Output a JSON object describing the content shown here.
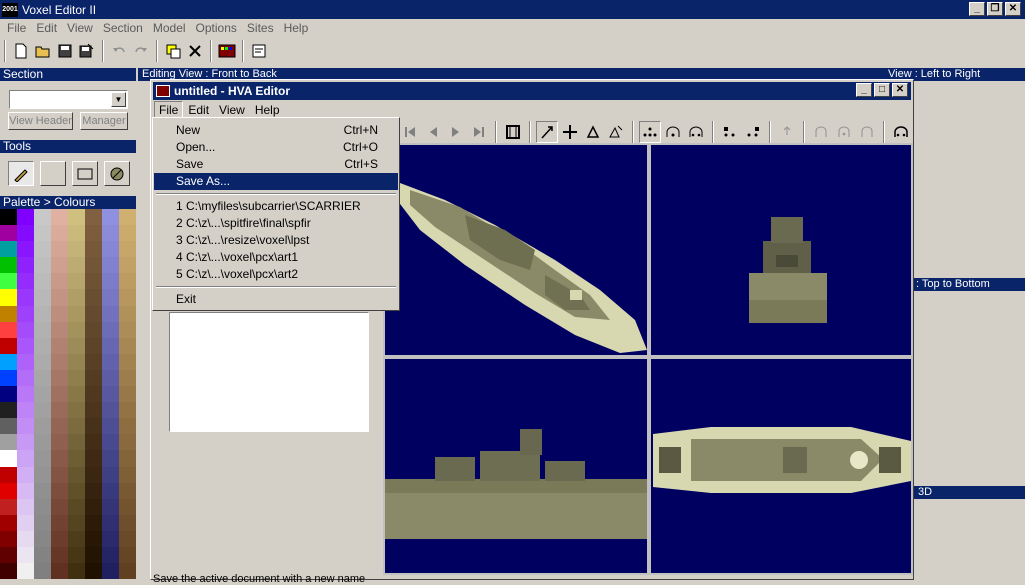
{
  "app": {
    "title": "Voxel Editor II",
    "icon": "2001"
  },
  "menubar": [
    "File",
    "Edit",
    "View",
    "Section",
    "Model",
    "Options",
    "Sites",
    "Help"
  ],
  "section": {
    "header": "Section",
    "view_header_btn": "View Header",
    "manager_btn": "Manager"
  },
  "tools": {
    "header": "Tools"
  },
  "palette": {
    "header": "Palette > Colours"
  },
  "views": {
    "editing": "Editing View : Front to Back",
    "left_right": "View : Left to Right",
    "top_bottom": ": Top to Bottom",
    "three_d": "3D"
  },
  "hva": {
    "title": "untitled - HVA Editor",
    "menus": [
      "File",
      "Edit",
      "View",
      "Help"
    ],
    "file_menu": [
      {
        "label": "New",
        "shortcut": "Ctrl+N"
      },
      {
        "label": "Open...",
        "shortcut": "Ctrl+O"
      },
      {
        "label": "Save",
        "shortcut": "Ctrl+S"
      },
      {
        "label": "Save As...",
        "shortcut": ""
      }
    ],
    "recent": [
      "1 C:\\myfiles\\subcarrier\\SCARRIER",
      "2 C:\\z\\...\\spitfire\\final\\spfir",
      "3 C:\\z\\...\\resize\\voxel\\lpst",
      "4 C:\\z\\...\\voxel\\pcx\\art1",
      "5 C:\\z\\...\\voxel\\pcx\\art2"
    ],
    "exit": "Exit",
    "status": "Save the active document with a new name"
  },
  "colors": {
    "title_active": "#0a246a",
    "view_bg": "#000060",
    "ship": "#7a7a58"
  }
}
